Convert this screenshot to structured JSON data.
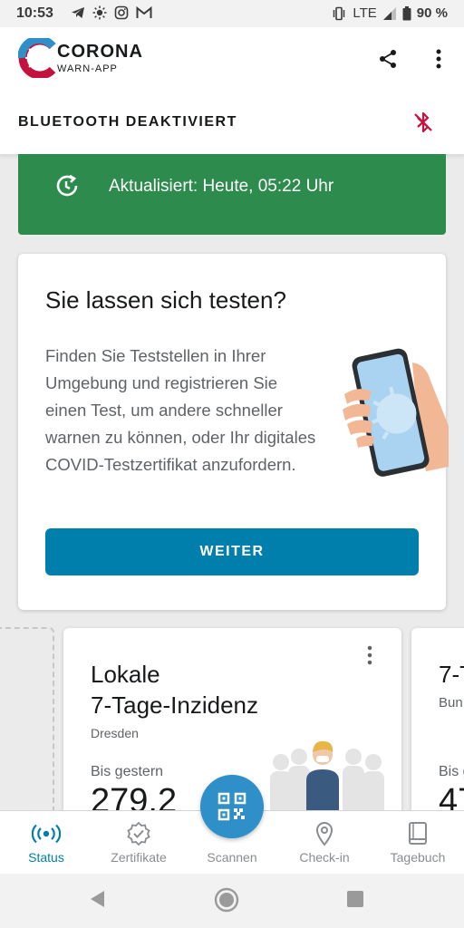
{
  "status_bar": {
    "time": "10:53",
    "network": "LTE",
    "battery": "90 %"
  },
  "app_bar": {
    "logo_title": "CORONA",
    "logo_subtitle": "WARN-APP",
    "share_icon": "share-icon",
    "menu_icon": "more-vertical-icon"
  },
  "bluetooth": {
    "label": "BLUETOOTH DEAKTIVIERT",
    "icon": "bluetooth-disabled-icon",
    "icon_color": "#c3123d"
  },
  "update_banner": {
    "text": "Aktualisiert: Heute, 05:22 Uhr",
    "color": "#2e8b4e"
  },
  "test_card": {
    "title": "Sie lassen sich testen?",
    "body": "Finden Sie Teststellen in Ihrer Umgebung und registrieren Sie einen Test, um andere schneller warnen zu können, oder Ihr digitales COVID-Testzertifikat anzufordern.",
    "button_label": "WEITER",
    "button_color": "#007fad"
  },
  "incidence_card": {
    "title_line1": "Lokale",
    "title_line2": "7-Tage-Inzidenz",
    "location": "Dresden",
    "since_label": "Bis gestern",
    "value": "279,2"
  },
  "next_card": {
    "title": "7-T",
    "subtitle": "Bun",
    "since_label": "Bis g",
    "value": "47"
  },
  "bottom_nav": {
    "items": [
      {
        "label": "Status",
        "icon": "broadcast-icon"
      },
      {
        "label": "Zertifikate",
        "icon": "certificate-badge-icon"
      },
      {
        "label": "Scannen",
        "icon": "qr-code-icon"
      },
      {
        "label": "Check-in",
        "icon": "location-pin-icon"
      },
      {
        "label": "Tagebuch",
        "icon": "book-icon"
      }
    ],
    "active_color": "#007fad"
  }
}
